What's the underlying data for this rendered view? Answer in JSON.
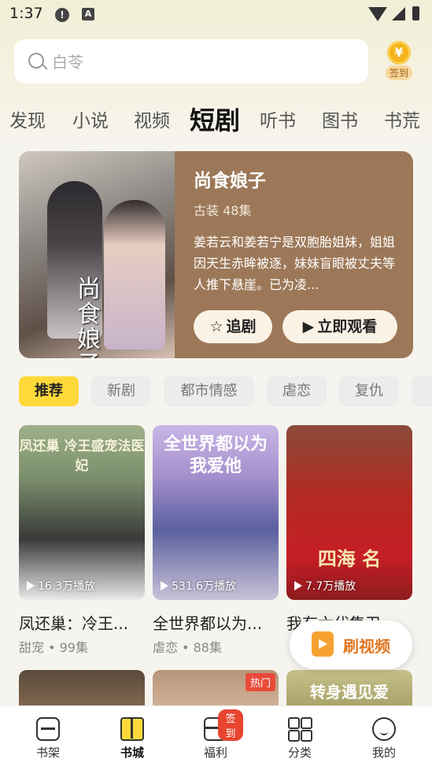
{
  "status_bar": {
    "time": "1:37"
  },
  "search": {
    "placeholder": "白苓"
  },
  "checkin": {
    "coin_symbol": "¥",
    "label": "签到"
  },
  "tabs": [
    {
      "label": "发现"
    },
    {
      "label": "小说"
    },
    {
      "label": "视频"
    },
    {
      "label": "短剧",
      "active": true
    },
    {
      "label": "听书"
    },
    {
      "label": "图书"
    },
    {
      "label": "书荒"
    }
  ],
  "hero": {
    "title": "尚食娘子",
    "meta": "古装 48集",
    "description": "姜若云和姜若宁是双胞胎姐妹，姐姐因天生赤眸被逐，妹妹盲眼被丈夫等人推下悬崖。已为凌...",
    "poster_calligraphy": "尚食娘子",
    "follow_label": "追剧",
    "watch_label": "立即观看"
  },
  "chips": [
    {
      "label": "推荐",
      "active": true
    },
    {
      "label": "新剧"
    },
    {
      "label": "都市情感"
    },
    {
      "label": "虐恋"
    },
    {
      "label": "复仇"
    }
  ],
  "cards": [
    {
      "title": "凤还巢：冷王...",
      "tags": "甜宠 • 99集",
      "plays": "16.3万播放",
      "cover_text": "凤还巢 冷王盛宠法医妃"
    },
    {
      "title": "全世界都以为...",
      "tags": "虐恋 • 88集",
      "plays": "531.6万播放",
      "cover_text": "全世界都以为我爱他"
    },
    {
      "title": "我有六代集卫...",
      "tags": "",
      "plays": "7.7万播放",
      "cover_text": "四海 名"
    }
  ],
  "row2": {
    "hot_badge": "热门",
    "cover3_text": "转身遇见爱"
  },
  "float_button": {
    "label": "刷视频"
  },
  "nav": [
    {
      "label": "书架"
    },
    {
      "label": "书城",
      "active": true
    },
    {
      "label": "福利",
      "badge": "签到"
    },
    {
      "label": "分类"
    },
    {
      "label": "我的"
    }
  ],
  "colors": {
    "accent": "#ffd93a",
    "hero_bg": "#9c7858",
    "float_text": "#e0751f",
    "badge": "#e8442f"
  }
}
